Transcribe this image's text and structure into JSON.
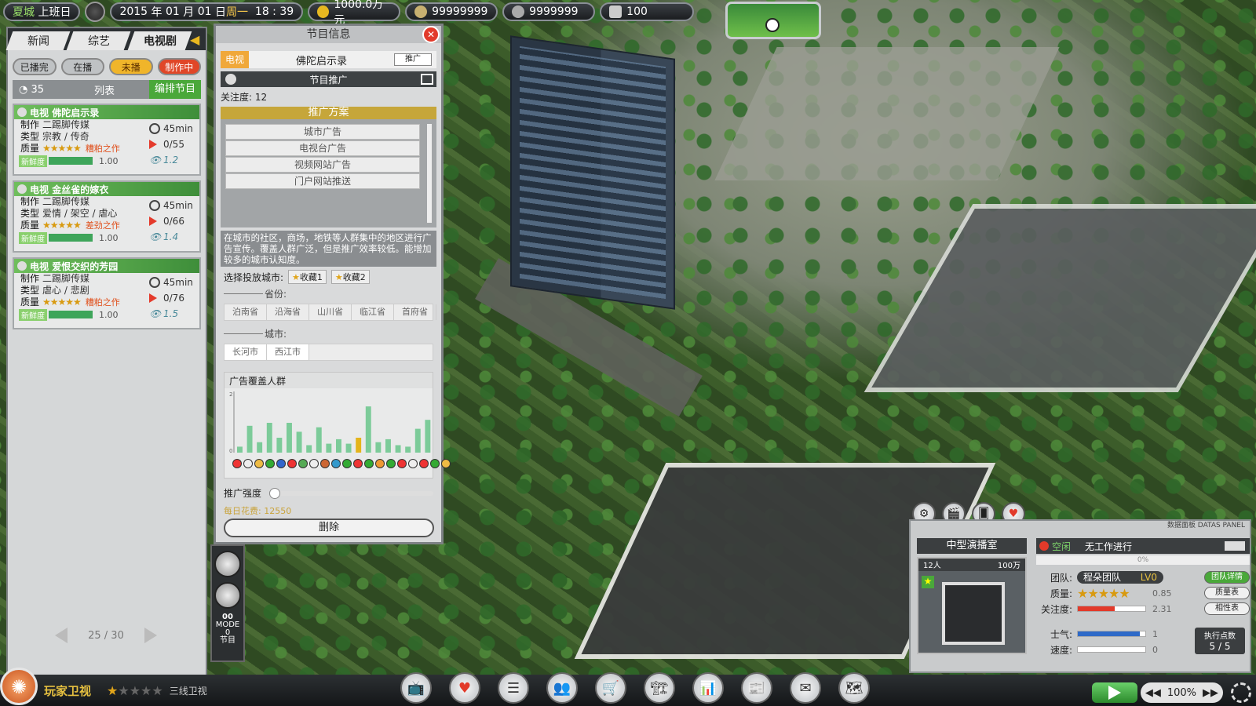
{
  "topbar": {
    "city": "夏城",
    "status": "上班日",
    "year": "2015",
    "year_unit": "年",
    "month": "01",
    "month_unit": "月",
    "day": "01",
    "day_unit": "日",
    "weekday": "周一",
    "time": "18 : 39",
    "money": "1000.0万元",
    "resource1": "99999999",
    "resource2": "9999999",
    "resource3": "100"
  },
  "left_panel": {
    "tabs": [
      "新闻",
      "综艺",
      "电视剧"
    ],
    "active_tab": "电视剧",
    "filters": [
      "已播完",
      "在播",
      "未播",
      "制作中"
    ],
    "count": "35",
    "list_label": "列表",
    "edit_button": "编排节目",
    "programs": [
      {
        "channel": "电视",
        "title": "佛陀启示录",
        "maker_label": "制作",
        "maker": "二踢脚传媒",
        "type_label": "类型",
        "type": "宗教 / 传奇",
        "quality_label": "质量",
        "quality_stars": 5,
        "quality_note": "糟粕之作",
        "fresh_label": "新鲜度",
        "fresh": "1.00",
        "duration": "45min",
        "episodes": "0/55",
        "rating": "1.2"
      },
      {
        "channel": "电视",
        "title": "金丝雀的嫁衣",
        "maker_label": "制作",
        "maker": "二踢脚传媒",
        "type_label": "类型",
        "type": "爱情 / 架空 / 虐心",
        "quality_label": "质量",
        "quality_stars": 5,
        "quality_note": "差劲之作",
        "fresh_label": "新鲜度",
        "fresh": "1.00",
        "duration": "45min",
        "episodes": "0/66",
        "rating": "1.4"
      },
      {
        "channel": "电视",
        "title": "爱恨交织的芳园",
        "maker_label": "制作",
        "maker": "二踢脚传媒",
        "type_label": "类型",
        "type": "虐心 / 悲剧",
        "quality_label": "质量",
        "quality_stars": 5,
        "quality_note": "糟粕之作",
        "fresh_label": "新鲜度",
        "fresh": "1.00",
        "duration": "45min",
        "episodes": "0/76",
        "rating": "1.5"
      }
    ],
    "page": "25 / 30"
  },
  "program_panel": {
    "title": "节目信息",
    "channel": "电视",
    "name": "佛陀启示录",
    "promote_button": "推广",
    "section": "节目推广",
    "attention_label": "关注度:",
    "attention": "12",
    "plan_header": "推广方案",
    "plans": [
      "城市广告",
      "电视台广告",
      "视频网站广告",
      "门户网站推送"
    ],
    "description": "在城市的社区，商场，地铁等人群集中的地区进行广告宣传。覆盖人群广泛，但是推广效率较低。能增加较多的城市认知度。",
    "city_select_label": "选择投放城市:",
    "favorites": [
      "收藏1",
      "收藏2"
    ],
    "province_label": "省份:",
    "provinces": [
      "泊南省",
      "沿海省",
      "山川省",
      "临江省",
      "首府省"
    ],
    "city_label": "城市:",
    "cities": [
      "长河市",
      "西江市"
    ],
    "chart_title": "广告覆盖人群",
    "intensity_label": "推广强度",
    "daily_cost_label": "每日花费:",
    "daily_cost": "12550",
    "delete_button": "删除"
  },
  "chart_data": {
    "type": "bar",
    "title": "广告覆盖人群",
    "ylim": [
      0,
      2
    ],
    "y_ticks": [
      "0",
      "2"
    ],
    "categories": 20,
    "values": [
      0.2,
      0.9,
      0.35,
      1.0,
      0.5,
      1.0,
      0.7,
      0.25,
      0.85,
      0.3,
      0.45,
      0.3,
      0.5,
      1.55,
      0.35,
      0.45,
      0.25,
      0.2,
      0.8,
      1.1
    ],
    "highlight_index": 12,
    "colors": {
      "bar": "#7ccb99",
      "highlight": "#e4b41a"
    }
  },
  "room_panel": {
    "tag": "数据面板 DATAS PANEL",
    "name": "中型演播室",
    "capacity": "12人",
    "cost": "100万",
    "state": "空闲",
    "task": "无工作进行",
    "progress": "0%",
    "team_label": "团队:",
    "team_name": "程朵团队",
    "team_level": "LV0",
    "team_button": "团队详情",
    "quality_label": "质量:",
    "quality_value": "0.85",
    "quality_stars": 5,
    "quality_button": "质量表",
    "attention_label": "关注度:",
    "attention_value": "2.31",
    "attention_fill": 0.55,
    "attention_button": "相性表",
    "morale_label": "士气:",
    "morale_value": "1",
    "morale_fill": 0.92,
    "speed_label": "速度:",
    "speed_value": "0",
    "speed_fill": 0,
    "action_label": "执行点数",
    "action_value": "5 / 5"
  },
  "time_strip": {
    "mode_top": "00",
    "mode_label": "MODE 0",
    "mode_sub": "节目"
  },
  "bottom": {
    "channel_logo": "✺",
    "channel_name": "玩家卫视",
    "channel_stars": 1,
    "tier": "三线卫视",
    "speed": "100%"
  },
  "colors": {
    "accent_green": "#4aa83a",
    "warn_red": "#e23a2a",
    "gold": "#e6c040"
  }
}
